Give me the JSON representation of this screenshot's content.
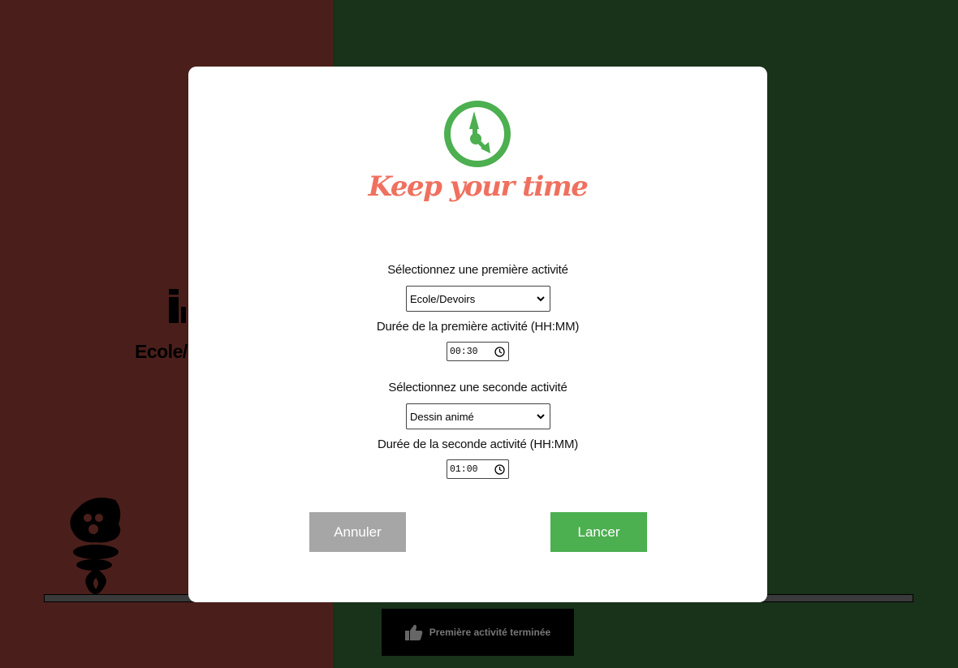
{
  "background": {
    "activity_label": "Ecole/D",
    "done_button_label": "Première activité terminée",
    "colors": {
      "left_panel": "#4a1f1b",
      "right_panel": "#19321a"
    }
  },
  "modal": {
    "brand": "Keep your time",
    "first_activity_label": "Sélectionnez une première activité",
    "first_activity_value": "Ecole/Devoirs",
    "first_duration_label": "Durée de la première activité (HH:MM)",
    "first_duration_value": "00:30",
    "second_activity_label": "Sélectionnez une seconde activité",
    "second_activity_value": "Dessin animé",
    "second_duration_label": "Durée de la seconde activité (HH:MM)",
    "second_duration_value": "01:00",
    "cancel_label": "Annuler",
    "launch_label": "Lancer",
    "colors": {
      "brand": "#f0705f",
      "accent": "#4caf50",
      "cancel": "#a6a6a6"
    }
  }
}
